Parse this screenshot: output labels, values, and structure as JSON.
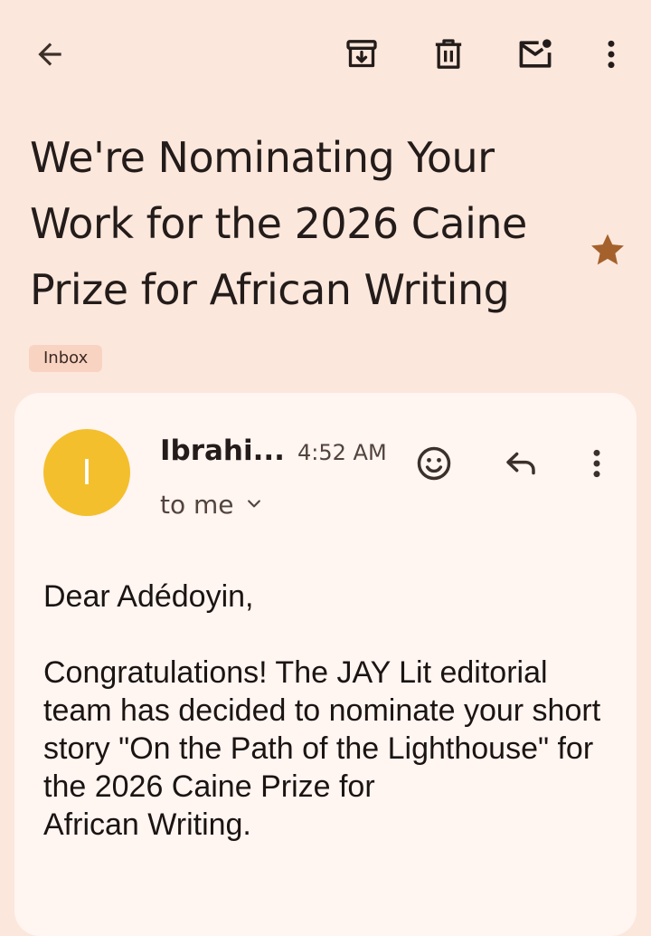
{
  "toolbar": {
    "back_icon": "arrow-left-icon",
    "archive_icon": "archive-icon",
    "delete_icon": "trash-icon",
    "mark_unread_icon": "mail-unread-icon",
    "more_icon": "more-vert-icon"
  },
  "email": {
    "subject": "We're Nominating Your Work for the 2026 Caine Prize for African Writing",
    "starred": true,
    "star_color": "#a5612c",
    "label": "Inbox"
  },
  "message": {
    "avatar_initial": "I",
    "avatar_color": "#f4bf2d",
    "sender": "Ibrahi...",
    "time": "4:52 AM",
    "recipient": "to me",
    "actions": {
      "react_icon": "emoji-smile-icon",
      "reply_icon": "reply-icon",
      "more_icon": "more-vert-icon"
    },
    "body": {
      "greeting": "Dear Adédoyin,",
      "paragraph": "Congratulations! The JAY Lit editorial team has decided to nominate your short story \"On the Path of the Lighthouse\" for the 2026 Caine Prize for\nAfrican Writing."
    }
  }
}
